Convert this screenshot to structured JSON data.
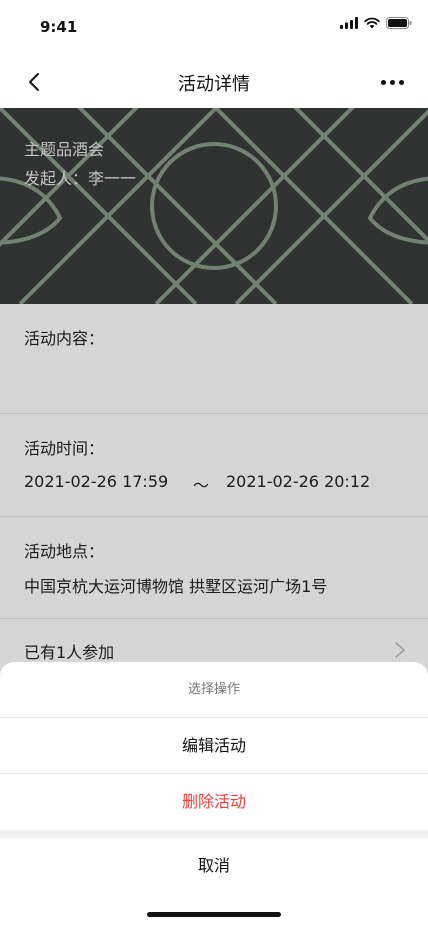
{
  "status_bar": {
    "time": "9:41",
    "icons": [
      "signal-icon",
      "wifi-icon",
      "battery-icon"
    ]
  },
  "nav": {
    "title": "活动详情",
    "back_icon": "chevron-left-icon",
    "more_icon": "more-icon"
  },
  "banner": {
    "title": "主题品酒会",
    "initiator": "发起人：李一一",
    "background_color": "#3a3c3b",
    "pattern_color": "#8a9a8a"
  },
  "details": {
    "content_label": "活动内容：",
    "content_value": "",
    "time_label": "活动时间：",
    "time_start": "2021-02-26   17:59",
    "time_separator": "～",
    "time_end": "2021-02-26   20:12",
    "place_label": "活动地点：",
    "place_value": "中国京杭大运河博物馆 拱墅区运河广场1号",
    "participants_label": "已有1人参加"
  },
  "action_sheet": {
    "title": "选择操作",
    "edit_label": "编辑活动",
    "delete_label": "删除活动",
    "cancel_label": "取消",
    "delete_color": "#e64340"
  }
}
